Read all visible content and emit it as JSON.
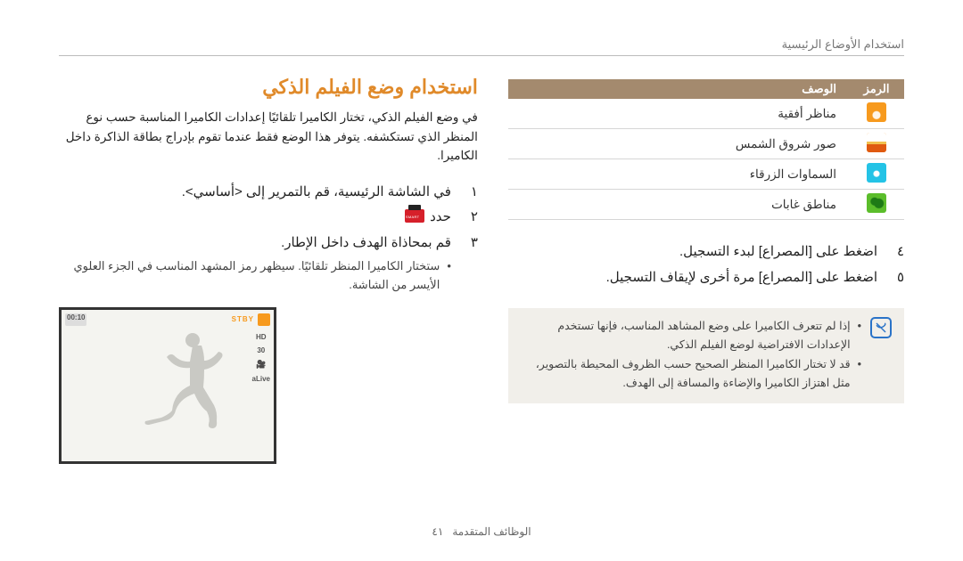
{
  "header": {
    "breadcrumb": "استخدام الأوضاع الرئيسية"
  },
  "title": "استخدام وضع الفيلم الذكي",
  "intro": "في وضع الفيلم الذكي، تختار الكاميرا تلقائيًا إعدادات الكاميرا المناسبة حسب نوع المنظر الذي تستكشفه. يتوفر هذا الوضع فقط عندما تقوم بإدراج بطاقة الذاكرة داخل الكاميرا.",
  "steps_right": [
    {
      "num": "١",
      "text": "في الشاشة الرئيسية، قم بالتمرير إلى <أساسي>."
    },
    {
      "num": "٢",
      "text": "حدد"
    },
    {
      "num": "٣",
      "text": "قم بمحاذاة الهدف داخل الإطار."
    }
  ],
  "sub_item": "ستختار الكاميرا المنظر تلقائيًا. سيظهر رمز المشهد المناسب في الجزء العلوي الأيسر من الشاشة.",
  "camera_preview": {
    "stby": "STBY",
    "counter": "00:10",
    "badges": [
      "HD",
      "30",
      "aLive"
    ]
  },
  "icon_table": {
    "head_icon": "الرمز",
    "head_desc": "الوصف",
    "rows": [
      {
        "desc": "مناظر أفقية"
      },
      {
        "desc": "صور شروق الشمس"
      },
      {
        "desc": "السماوات الزرقاء"
      },
      {
        "desc": "مناطق غابات"
      }
    ]
  },
  "steps_left": [
    {
      "num": "٤",
      "text": "اضغط على [المصراع] لبدء التسجيل."
    },
    {
      "num": "٥",
      "text": "اضغط على [المصراع] مرة أخرى لإيقاف التسجيل."
    }
  ],
  "note": {
    "items": [
      "إذا لم تتعرف الكاميرا على وضع المشاهد المناسب، فإنها تستخدم الإعدادات الافتراضية لوضع الفيلم الذكي.",
      "قد لا تختار الكاميرا المنظر الصحيح حسب الظروف المحيطة بالتصوير، مثل اهتزاز الكاميرا والإضاءة والمسافة إلى الهدف."
    ]
  },
  "footer": {
    "section": "الوظائف المتقدمة",
    "page": "٤١"
  }
}
